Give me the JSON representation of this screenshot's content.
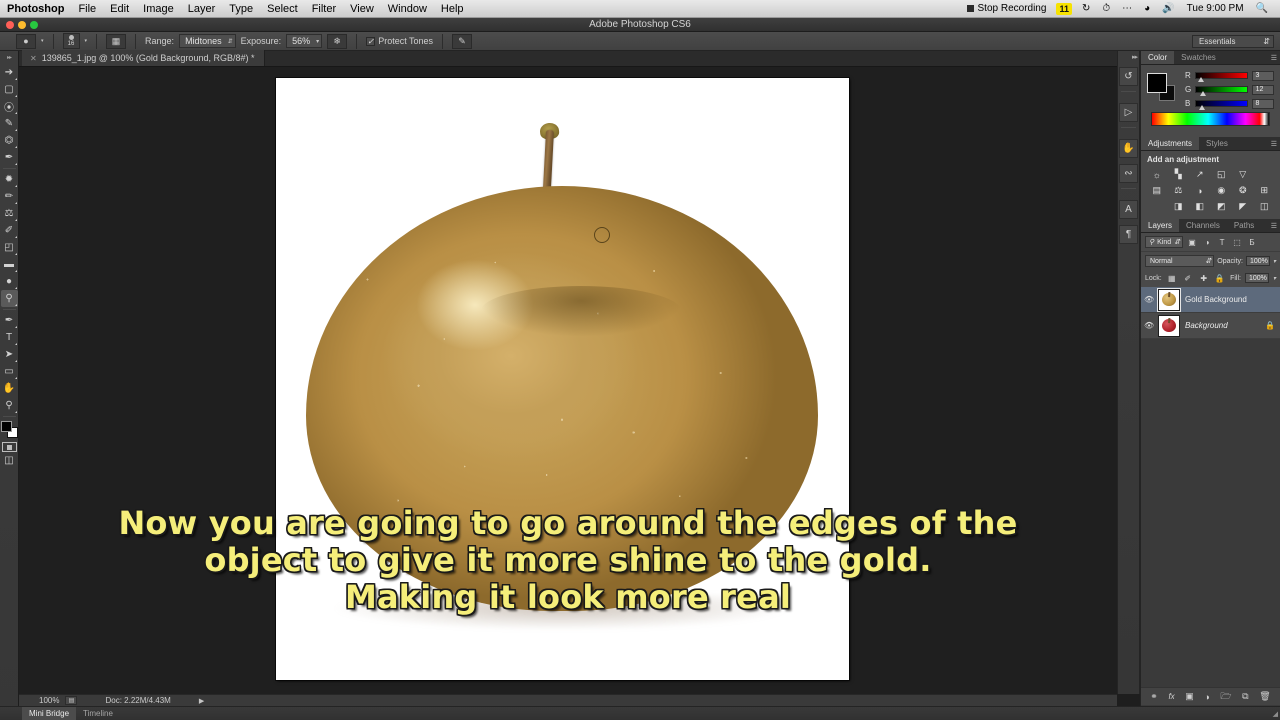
{
  "macbar": {
    "apple_icon": "apple-icon",
    "menus": [
      "Photoshop",
      "File",
      "Edit",
      "Image",
      "Layer",
      "Type",
      "Select",
      "Filter",
      "View",
      "Window",
      "Help"
    ],
    "status": {
      "stop_recording": "Stop Recording",
      "recording_time": "11",
      "recording_badge_color": "#f6e200",
      "sync_icon": "sync-icon",
      "timemachine_icon": "clock-icon",
      "ellipsis_icon": "ellipsis-icon",
      "wifi_icon": "wifi-icon",
      "volume_icon": "volume-icon",
      "clock": "Tue 9:00 PM",
      "spotlight_icon": "search-icon"
    }
  },
  "window": {
    "title": "Adobe Photoshop CS6",
    "close_color": "#ff5f57",
    "minimize_color": "#febc2e",
    "zoom_color": "#28c840"
  },
  "options_bar": {
    "active_tool_icon": "dodge-tool-icon",
    "brush_size": "16",
    "brush_preset_icon": "brush-preset-icon",
    "airbrush_icon": "airbrush-icon",
    "range_label": "Range:",
    "range_value": "Midtones",
    "exposure_label": "Exposure:",
    "exposure_value": "56%",
    "pressure_icon": "pressure-icon",
    "protect_tones_label": "Protect Tones",
    "protect_tones_checked": true,
    "tablet_icon": "tablet-pressure-icon",
    "workspace": "Essentials"
  },
  "document_tab": {
    "close_icon": "close-icon",
    "title": "139865_1.jpg @ 100% (Gold Background, RGB/8#) *"
  },
  "toolbar": {
    "tools": [
      {
        "name": "move-tool",
        "glyph": "↖"
      },
      {
        "name": "marquee-tool",
        "glyph": "▢"
      },
      {
        "name": "lasso-tool",
        "glyph": "⤵"
      },
      {
        "name": "quick-selection-tool",
        "glyph": "✎"
      },
      {
        "name": "crop-tool",
        "glyph": "⌙"
      },
      {
        "name": "eyedropper-tool",
        "glyph": "✒"
      },
      {
        "name": "spot-healing-brush-tool",
        "glyph": "❁"
      },
      {
        "name": "brush-tool",
        "glyph": "✐"
      },
      {
        "name": "clone-stamp-tool",
        "glyph": "⚲"
      },
      {
        "name": "history-brush-tool",
        "glyph": "✐"
      },
      {
        "name": "eraser-tool",
        "glyph": "◰"
      },
      {
        "name": "gradient-tool",
        "glyph": "▤"
      },
      {
        "name": "blur-tool",
        "glyph": "●"
      },
      {
        "name": "dodge-tool",
        "glyph": "⚲",
        "active": true
      },
      {
        "name": "pen-tool",
        "glyph": "✒"
      },
      {
        "name": "type-tool",
        "glyph": "T"
      },
      {
        "name": "path-selection-tool",
        "glyph": "➤"
      },
      {
        "name": "rectangle-tool",
        "glyph": "▭"
      },
      {
        "name": "hand-tool",
        "glyph": "✋"
      },
      {
        "name": "zoom-tool",
        "glyph": "⚲"
      }
    ],
    "default_colors_icon": "default-colors-icon",
    "swap_colors_icon": "swap-colors-icon",
    "foreground_color": "#000000",
    "background_color": "#ffffff",
    "quick_mask_icon": "quick-mask-icon",
    "screen_mode_icon": "screen-mode-icon"
  },
  "canvas": {
    "zoom": "100%",
    "doc_info": "Doc: 2.22M/4.43M",
    "brush_cursor": "brush-cursor",
    "subtitles": [
      "Now you are going to go around the edges of the",
      "object to give it more shine to the gold.",
      "Making it look more real"
    ],
    "subtitle_color": "#f5ee7a"
  },
  "panel_strip": {
    "collapse_icon": "collapse-panels-icon",
    "icons": [
      {
        "name": "history-panel-icon",
        "glyph": "↺"
      },
      {
        "name": "actions-panel-icon",
        "glyph": "▷"
      },
      {
        "name": "brush-panel-icon",
        "glyph": "✎"
      },
      {
        "name": "clone-source-panel-icon",
        "glyph": "⁂"
      },
      {
        "name": "character-panel-icon",
        "glyph": "A"
      },
      {
        "name": "paragraph-panel-icon",
        "glyph": "¶"
      }
    ]
  },
  "color_panel": {
    "tabs": [
      "Color",
      "Swatches"
    ],
    "active_tab": "Color",
    "menu_icon": "panel-menu-icon",
    "foreground_swatch": "#000000",
    "background_swatch": "#0c0c0c",
    "channels": [
      {
        "label": "R",
        "value": "3"
      },
      {
        "label": "G",
        "value": "12"
      },
      {
        "label": "B",
        "value": "8"
      }
    ]
  },
  "adjustments_panel": {
    "tabs": [
      "Adjustments",
      "Styles"
    ],
    "active_tab": "Adjustments",
    "menu_icon": "panel-menu-icon",
    "heading": "Add an adjustment",
    "row1": [
      {
        "name": "brightness-contrast-icon",
        "glyph": "☀"
      },
      {
        "name": "levels-icon",
        "glyph": "ᵛ"
      },
      {
        "name": "curves-icon",
        "glyph": "↗"
      },
      {
        "name": "exposure-icon",
        "glyph": "◧"
      },
      {
        "name": "vibrance-icon",
        "glyph": "▽"
      }
    ],
    "row2": [
      {
        "name": "hue-saturation-icon",
        "glyph": "▤"
      },
      {
        "name": "color-balance-icon",
        "glyph": "⚖"
      },
      {
        "name": "black-white-icon",
        "glyph": "◑"
      },
      {
        "name": "photo-filter-icon",
        "glyph": "◎"
      },
      {
        "name": "channel-mixer-icon",
        "glyph": "❂"
      },
      {
        "name": "color-lookup-icon",
        "glyph": "⊞"
      }
    ],
    "row3": [
      {
        "name": "invert-icon",
        "glyph": "◨"
      },
      {
        "name": "posterize-icon",
        "glyph": "◧"
      },
      {
        "name": "threshold-icon",
        "glyph": "◩"
      },
      {
        "name": "gradient-map-icon",
        "glyph": "◤"
      },
      {
        "name": "selective-color-icon",
        "glyph": "◫"
      }
    ]
  },
  "layers_panel": {
    "tabs": [
      "Layers",
      "Channels",
      "Paths"
    ],
    "active_tab": "Layers",
    "menu_icon": "panel-menu-icon",
    "filter_kind": "Kind",
    "filter_icons": [
      {
        "name": "filter-pixel-icon",
        "glyph": "▣"
      },
      {
        "name": "filter-adjustment-icon",
        "glyph": "◑"
      },
      {
        "name": "filter-type-icon",
        "glyph": "T"
      },
      {
        "name": "filter-shape-icon",
        "glyph": "⬚"
      },
      {
        "name": "filter-smart-object-icon",
        "glyph": "⊞"
      }
    ],
    "blend_mode": "Normal",
    "opacity_label": "Opacity:",
    "opacity_value": "100%",
    "lock_label": "Lock:",
    "lock_icons": [
      {
        "name": "lock-transparent-pixels-icon",
        "glyph": "▦"
      },
      {
        "name": "lock-image-pixels-icon",
        "glyph": "✐"
      },
      {
        "name": "lock-position-icon",
        "glyph": "✛"
      },
      {
        "name": "lock-all-icon",
        "glyph": "Б"
      }
    ],
    "fill_label": "Fill:",
    "fill_value": "100%",
    "layers": [
      {
        "name": "Gold Background",
        "visible": true,
        "selected": true,
        "locked": false,
        "thumb": "gold-apple-thumbnail"
      },
      {
        "name": "Background",
        "visible": true,
        "selected": false,
        "locked": true,
        "thumb": "red-apple-thumbnail"
      }
    ],
    "footer_icons": [
      {
        "name": "link-layers-icon",
        "glyph": "⚭"
      },
      {
        "name": "layer-style-icon",
        "glyph": "fx"
      },
      {
        "name": "layer-mask-icon",
        "glyph": "▣"
      },
      {
        "name": "new-fill-adjustment-icon",
        "glyph": "◑"
      },
      {
        "name": "new-group-icon",
        "glyph": "▰"
      },
      {
        "name": "new-layer-icon",
        "glyph": "❐"
      },
      {
        "name": "delete-layer-icon",
        "glyph": "⌧"
      }
    ]
  },
  "bottom_bar": {
    "tabs": [
      "Mini Bridge",
      "Timeline"
    ],
    "active_tab": "Mini Bridge",
    "resize_grip_icon": "resize-grip-icon"
  }
}
